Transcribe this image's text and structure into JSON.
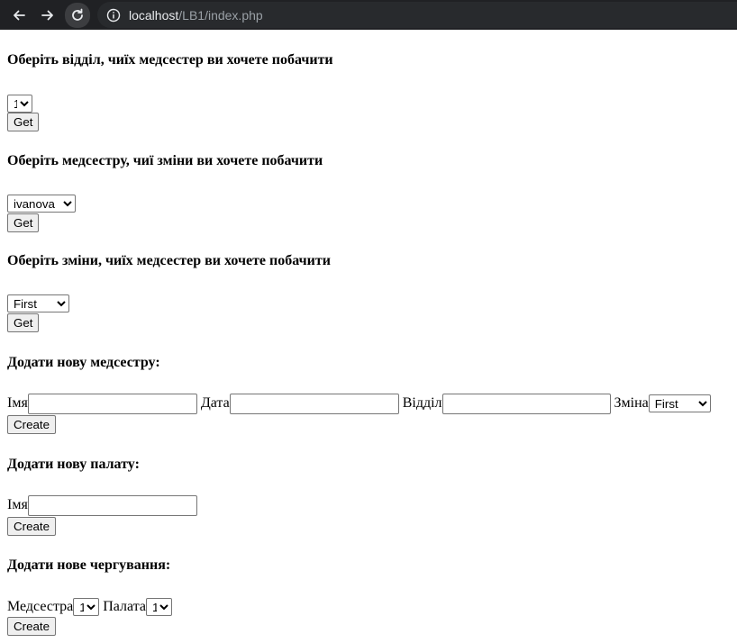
{
  "browser": {
    "url_host": "localhost",
    "url_path": "/LB1/index.php"
  },
  "sections": {
    "department": {
      "heading": "Оберіть відділ, чиїх медсестер ви хочете побачити",
      "selected": "1",
      "button": "Get"
    },
    "nurse": {
      "heading": "Оберіть медсестру, чиї зміни ви хочете побачити",
      "selected": "ivanova",
      "button": "Get"
    },
    "shift": {
      "heading": "Оберіть зміни, чиїх медсестер ви хочете побачити",
      "selected": "First",
      "button": "Get"
    },
    "add_nurse": {
      "heading": "Додати нову медсестру:",
      "name_label": "Імя",
      "date_label": "Дата",
      "department_label": "Відділ",
      "shift_label": "Зміна",
      "shift_selected": "First",
      "button": "Create"
    },
    "add_ward": {
      "heading": "Додати нову палату:",
      "name_label": "Імя",
      "button": "Create"
    },
    "add_duty": {
      "heading": "Додати нове чергування:",
      "nurse_label": "Медсестра",
      "nurse_selected": "1",
      "ward_label": "Палата",
      "ward_selected": "1",
      "button": "Create"
    }
  }
}
